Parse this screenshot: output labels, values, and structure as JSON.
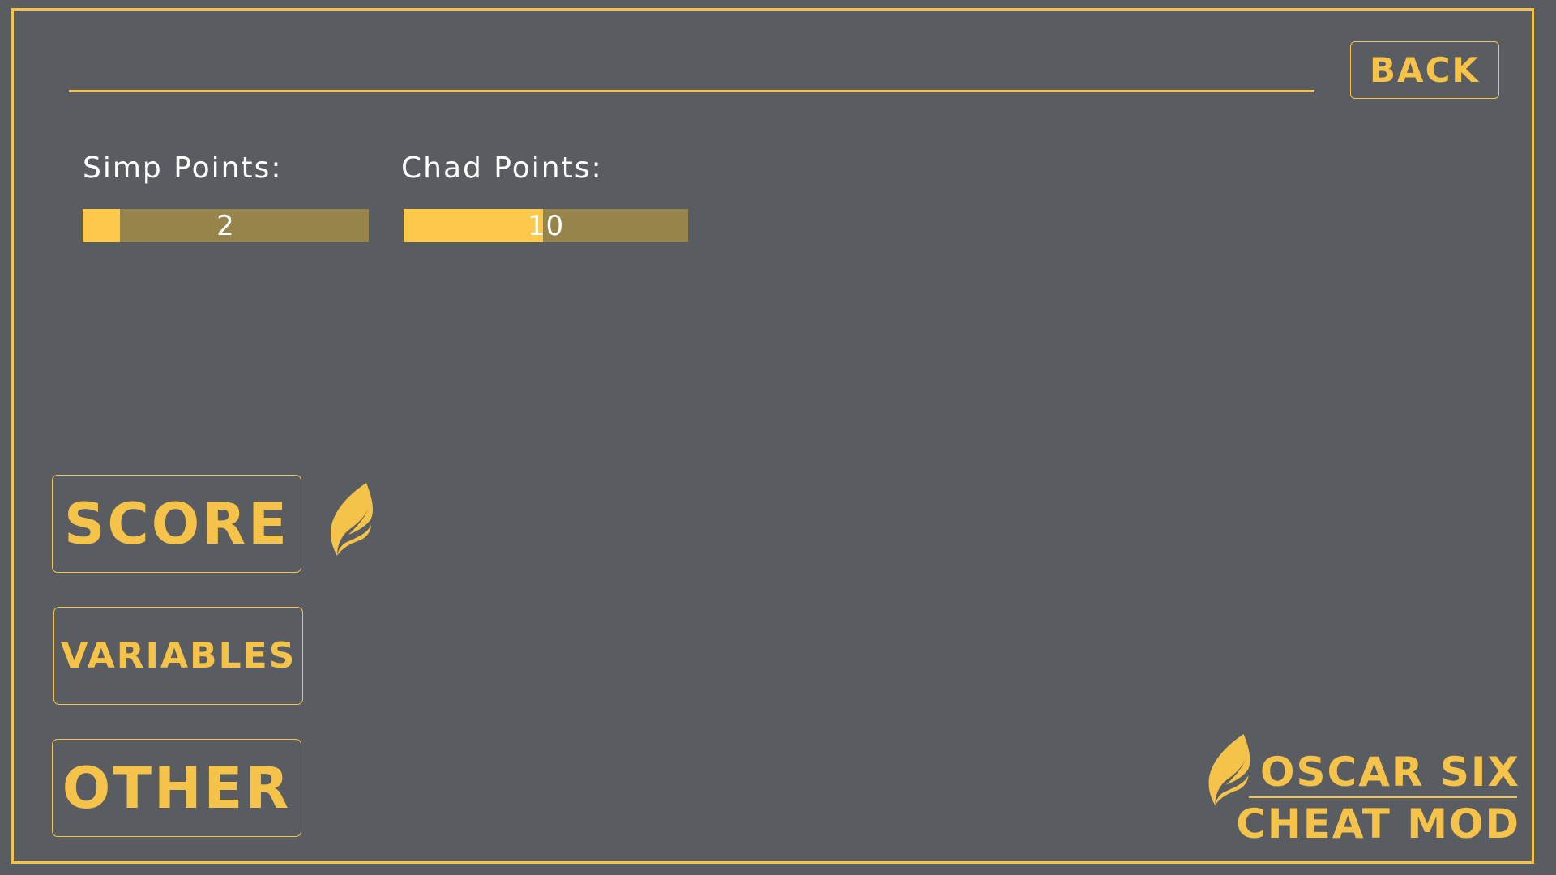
{
  "header": {
    "back_label": "BACK"
  },
  "stats": {
    "simp": {
      "label": "Simp Points:",
      "value": "2",
      "fill_fraction": 0.13
    },
    "chad": {
      "label": "Chad Points:",
      "value": "10",
      "fill_fraction": 0.49
    }
  },
  "menu": {
    "score_label": "SCORE",
    "variables_label": "VARIABLES",
    "other_label": "OTHER"
  },
  "brand": {
    "line1": "OSCAR SIX",
    "line2": "CHEAT MOD"
  },
  "icons": {
    "active_marker": "flame-icon",
    "brand_logo": "flame-icon"
  },
  "colors": {
    "background": "#595c60",
    "accent": "#f5c24a",
    "bar_fill": "#fec84a",
    "bar_track": "#97844a",
    "text": "#ffffff"
  }
}
